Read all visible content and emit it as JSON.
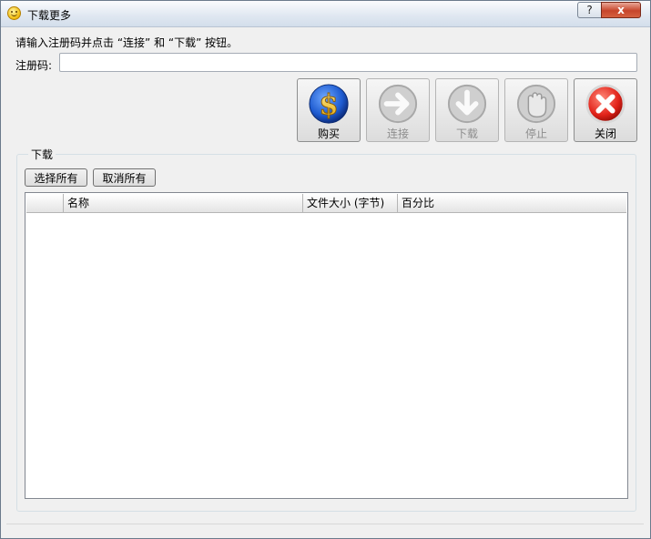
{
  "window": {
    "title": "下载更多",
    "icon": "smiley-app-icon",
    "help_label": "?",
    "close_label": "x"
  },
  "prompt": "请输入注册码并点击 “连接” 和 “下载” 按钮。",
  "registration": {
    "label": "注册码:",
    "value": ""
  },
  "toolbar": {
    "buy": {
      "label": "购买",
      "icon": "dollar-coin-icon",
      "enabled": true
    },
    "connect": {
      "label": "连接",
      "icon": "arrow-right-icon",
      "enabled": false
    },
    "download": {
      "label": "下载",
      "icon": "arrow-down-icon",
      "enabled": false
    },
    "stop": {
      "label": "停止",
      "icon": "hand-stop-icon",
      "enabled": false
    },
    "close": {
      "label": "关闭",
      "icon": "close-x-icon",
      "enabled": true
    }
  },
  "download_group": {
    "title": "下载",
    "select_all_label": "选择所有",
    "deselect_all_label": "取消所有",
    "columns": [
      "",
      "名称",
      "文件大小 (字节)",
      "百分比"
    ],
    "rows": []
  },
  "colors": {
    "accent_red": "#e2231a",
    "coin_blue": "#1e5bd0",
    "coin_gold": "#f4c21a"
  }
}
